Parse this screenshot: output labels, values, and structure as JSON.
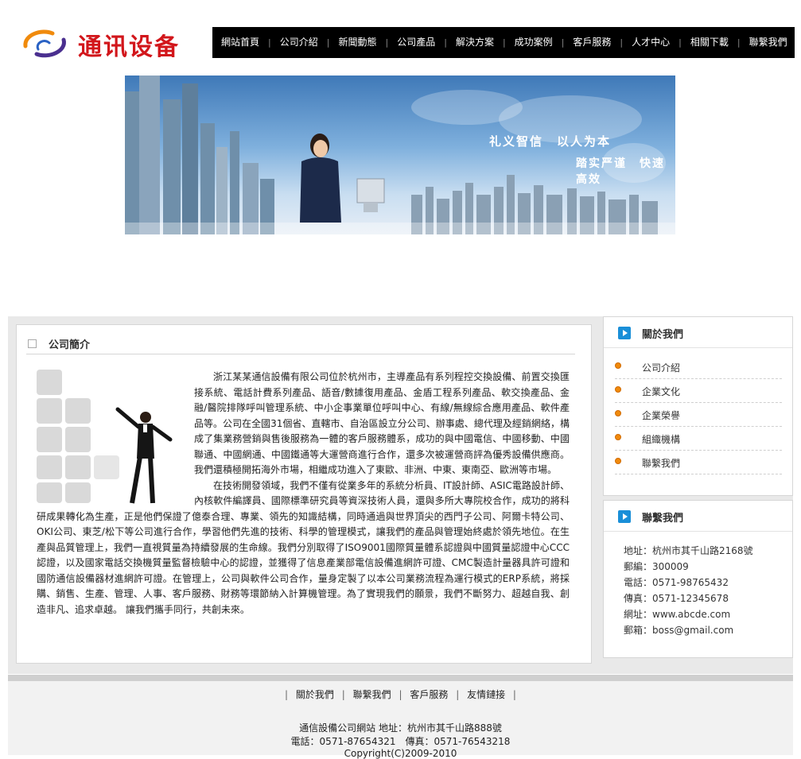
{
  "header": {
    "logo_text": "通讯设备"
  },
  "nav": {
    "items": [
      "網站首頁",
      "公司介紹",
      "新聞動態",
      "公司產品",
      "解決方案",
      "成功案例",
      "客戶服務",
      "人才中心",
      "相關下載",
      "聯繫我們"
    ]
  },
  "banner": {
    "slogan1": "礼义智信　以人为本",
    "slogan2": "踏实严谨　快速高效"
  },
  "intro": {
    "title": "公司簡介",
    "paragraph1": "浙江某某通信設備有限公司位於杭州市，主導產品有系列程控交換設備、前置交換匯接系統、電話計費系列產品、語音/數據復用產品、金盾工程系列產品、軟交換產品、金融/醫院排隊呼叫管理系統、中小企事業單位呼叫中心、有線/無線綜合應用產品、軟件產品等。公司在全國31個省、直轄市、自治區設立分公司、辦事處、總代理及經銷網絡，構成了集業務營銷與售後服務為一體的客戶服務體系，成功的與中國電信、中國移動、中國聯通、中國網通、中國鐵通等大運營商進行合作，還多次被運營商評為優秀設備供應商。我們還積極開拓海外市場，相繼成功進入了東歐、非洲、中東、東南亞、歐洲等市場。",
    "paragraph2": "在技術開發領域，我們不僅有從業多年的系統分析員、IT設計師、ASIC電路設計師、內核軟件編譯員、國際標準研究員等資深技術人員，還與多所大專院校合作，成功的將科研成果轉化為生產，正是他們保證了億泰合理、專業、領先的知識結構，同時通過與世界頂尖的西門子公司、阿爾卡特公司、OKI公司、東芝/松下等公司進行合作，學習他們先進的技術、科學的管理模式，讓我們的產品與管理始終處於領先地位。在生產與品質管理上，我們一直視質量為持續發展的生命線。我們分別取得了ISO9001國際質量體系認證與中國質量認證中心CCC認證，以及國家電話交換機質量監督檢驗中心的認證，並獲得了信息產業部電信設備進網許可證、CMC製造計量器具許可證和國防通信設備器材進網許可證。在管理上，公司與軟件公司合作，量身定製了以本公司業務流程為運行模式的ERP系統，將採購、銷售、生產、管理、人事、客戶服務、財務等環節納入計算機管理。為了實現我們的願景，我們不斷努力、超越自我、創造非凡、追求卓越。 讓我們攜手同行，共創未來。"
  },
  "about": {
    "title": "關於我們",
    "items": [
      "公司介紹",
      "企業文化",
      "企業榮譽",
      "組織機構",
      "聯繫我們"
    ]
  },
  "contact": {
    "title": "聯繫我們",
    "lines": [
      "地址：杭州市其千山路2168號",
      "郵編：300009",
      "電話：0571-98765432",
      "傳真：0571-12345678",
      "網址：www.abcde.com",
      "郵箱：boss@gmail.com"
    ]
  },
  "footer": {
    "links": [
      "關於我們",
      "聯繫我們",
      "客戶服務",
      "友情鏈接"
    ],
    "line1": "通信設備公司網站 地址：杭州市其千山路888號",
    "line2": "電話：0571-87654321　傳真：0571-76543218",
    "line3": "Copyright(C)2009-2010"
  },
  "colors": {
    "logo_red": "#d2161b",
    "nav_bg": "#000000",
    "bullet_orange": "#f08a0c",
    "icon_blue": "#1a8fd8"
  }
}
